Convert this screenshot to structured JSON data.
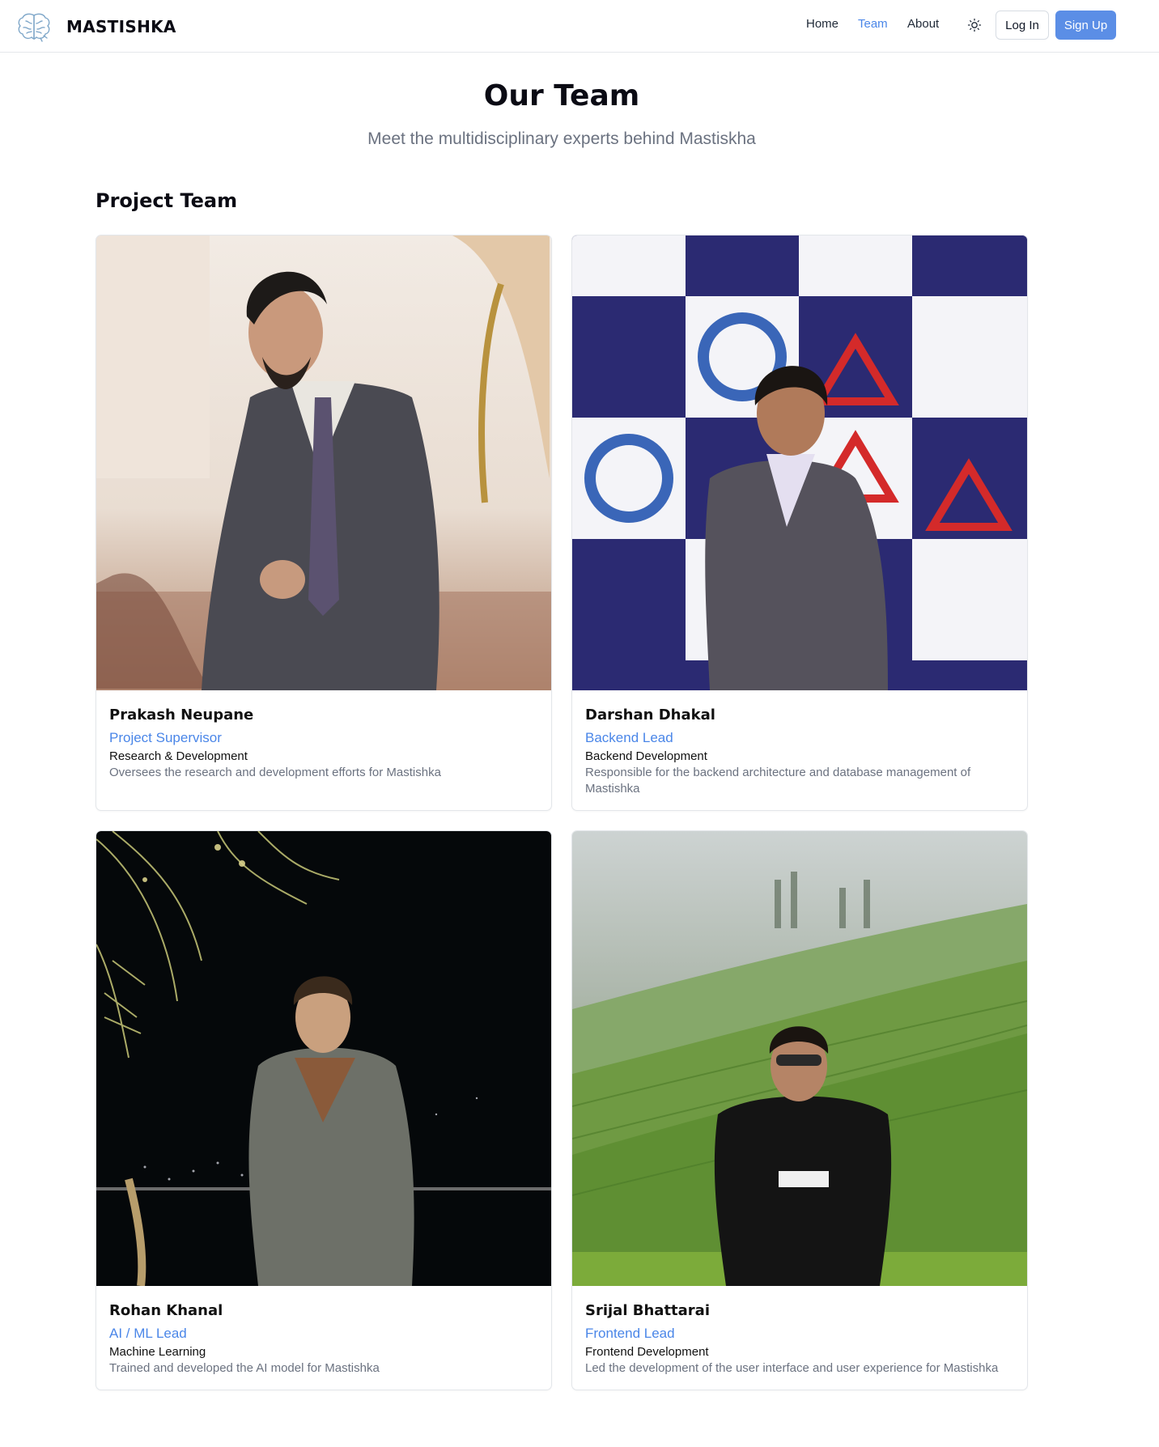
{
  "header": {
    "brand": "MASTISHKA",
    "nav": [
      "Home",
      "Team",
      "About"
    ],
    "active_nav": "Team",
    "login_label": "Log In",
    "signup_label": "Sign Up",
    "accent_color": "#4a86e8"
  },
  "hero": {
    "title": "Our Team",
    "subtitle": "Meet the multidisciplinary experts behind Mastiskha"
  },
  "section": {
    "title": "Project Team"
  },
  "team": [
    {
      "name": "Prakash Neupane",
      "role": "Project Supervisor",
      "department": "Research & Development",
      "description": "Oversees the research and development efforts for Mastishka"
    },
    {
      "name": "Darshan Dhakal",
      "role": "Backend Lead",
      "department": "Backend Development",
      "description": "Responsible for the backend architecture and database management of Mastishka"
    },
    {
      "name": "Rohan Khanal",
      "role": "AI / ML Lead",
      "department": "Machine Learning",
      "description": "Trained and developed the AI model for Mastishka"
    },
    {
      "name": "Srijal Bhattarai",
      "role": "Frontend Lead",
      "department": "Frontend Development",
      "description": "Led the development of the user interface and user experience for Mastishka"
    }
  ]
}
